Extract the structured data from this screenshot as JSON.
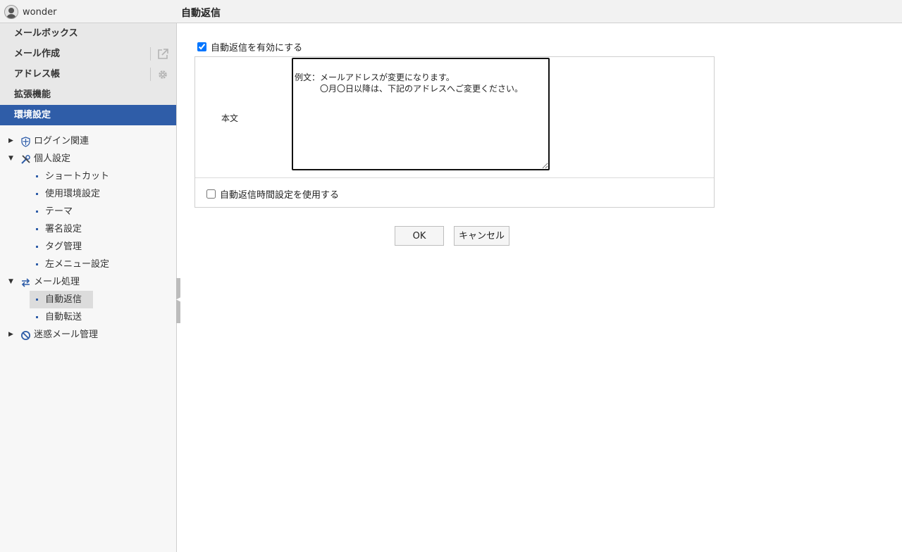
{
  "user": {
    "name": "wonder"
  },
  "page": {
    "title": "自動返信"
  },
  "sidebar": {
    "nav": [
      {
        "label": "メールボックス"
      },
      {
        "label": "メール作成",
        "icon": "external-link-icon"
      },
      {
        "label": "アドレス帳",
        "icon": "gear-icon"
      },
      {
        "label": "拡張機能"
      },
      {
        "label": "環境設定",
        "active": true
      }
    ],
    "tree": {
      "login": {
        "label": "ログイン関連"
      },
      "personal": {
        "label": "個人設定",
        "children": [
          "ショートカット",
          "使用環境設定",
          "テーマ",
          "署名設定",
          "タグ管理",
          "左メニュー設定"
        ]
      },
      "mail": {
        "label": "メール処理",
        "children": [
          "自動返信",
          "自動転送"
        ],
        "selected": "自動返信"
      },
      "spam": {
        "label": "迷惑メール管理"
      }
    }
  },
  "form": {
    "enable_label": "自動返信を有効にする",
    "enable_checked": true,
    "body_label": "本文",
    "body_text": "例文：メールアドレスが変更になります。\n　　　〇月〇日以降は、下記のアドレスへご変更ください。",
    "time_label": "自動返信時間設定を使用する",
    "time_checked": false
  },
  "buttons": {
    "ok": "OK",
    "cancel": "キャンセル"
  },
  "colors": {
    "accent": "#2f5da8"
  }
}
